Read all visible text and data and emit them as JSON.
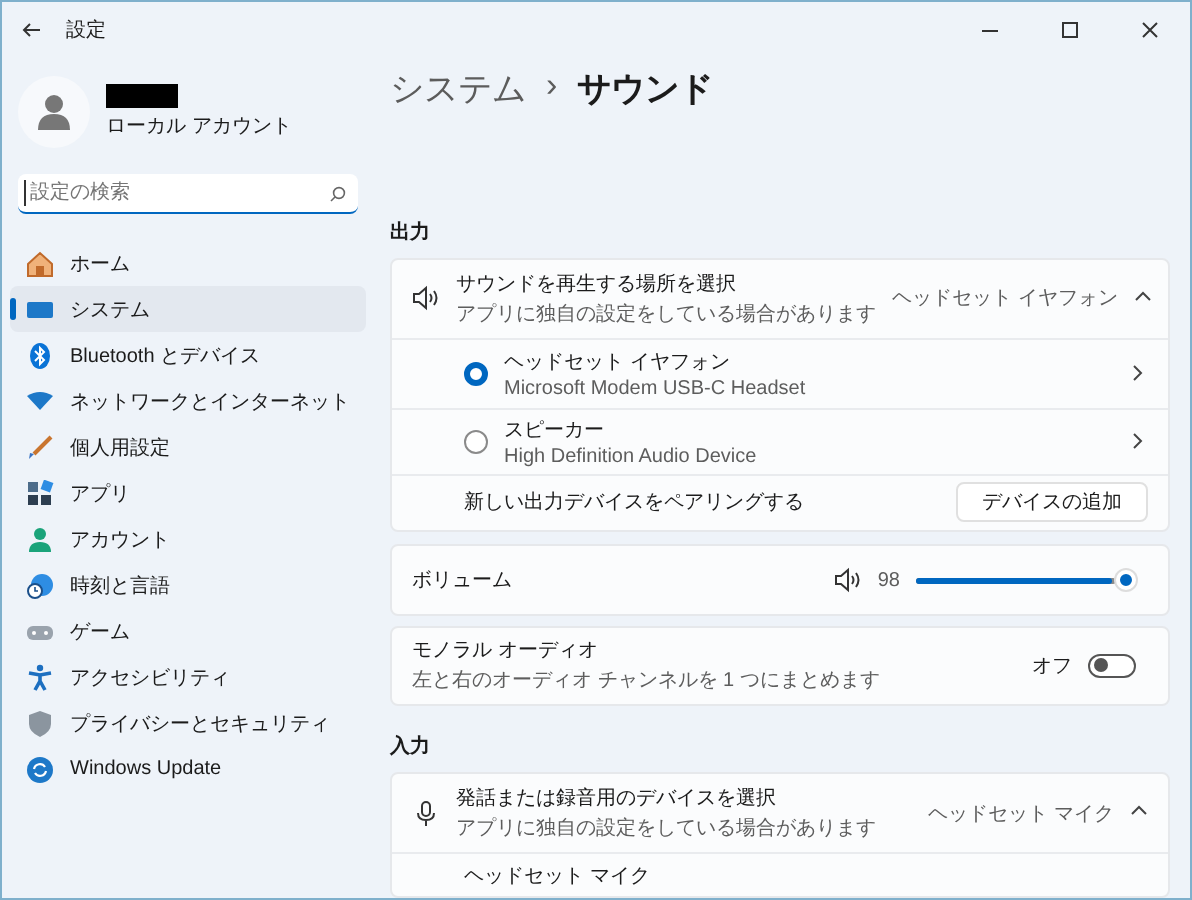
{
  "window": {
    "title": "設定"
  },
  "account": {
    "type_label": "ローカル アカウント"
  },
  "search": {
    "placeholder": "設定の検索"
  },
  "sidebar": {
    "items": [
      {
        "label": "ホーム",
        "selected": false
      },
      {
        "label": "システム",
        "selected": true
      },
      {
        "label": "Bluetooth とデバイス",
        "selected": false
      },
      {
        "label": "ネットワークとインターネット",
        "selected": false
      },
      {
        "label": "個人用設定",
        "selected": false
      },
      {
        "label": "アプリ",
        "selected": false
      },
      {
        "label": "アカウント",
        "selected": false
      },
      {
        "label": "時刻と言語",
        "selected": false
      },
      {
        "label": "ゲーム",
        "selected": false
      },
      {
        "label": "アクセシビリティ",
        "selected": false
      },
      {
        "label": "プライバシーとセキュリティ",
        "selected": false
      },
      {
        "label": "Windows Update",
        "selected": false
      }
    ]
  },
  "breadcrumb": {
    "parent": "システム",
    "separator": "›",
    "current": "サウンド"
  },
  "output": {
    "heading": "出力",
    "picker": {
      "title": "サウンドを再生する場所を選択",
      "subtitle": "アプリに独自の設定をしている場合があります",
      "value": "ヘッドセット イヤフォン",
      "expanded": true
    },
    "devices": [
      {
        "name": "ヘッドセット イヤフォン",
        "detail": "Microsoft Modem USB-C Headset",
        "selected": true
      },
      {
        "name": "スピーカー",
        "detail": "High Definition Audio Device",
        "selected": false
      }
    ],
    "pair": {
      "label": "新しい出力デバイスをペアリングする",
      "button": "デバイスの追加"
    }
  },
  "volume": {
    "label": "ボリューム",
    "reading": "98",
    "level": 0.98
  },
  "mono": {
    "title": "モノラル オーディオ",
    "subtitle": "左と右のオーディオ チャンネルを 1 つにまとめます",
    "state_label": "オフ",
    "on": false
  },
  "input": {
    "heading": "入力",
    "picker": {
      "title": "発話または録音用のデバイスを選択",
      "subtitle": "アプリに独自の設定をしている場合があります",
      "value": "ヘッドセット マイク",
      "expanded": true
    },
    "devices": [
      {
        "name": "ヘッドセット マイク"
      }
    ]
  }
}
